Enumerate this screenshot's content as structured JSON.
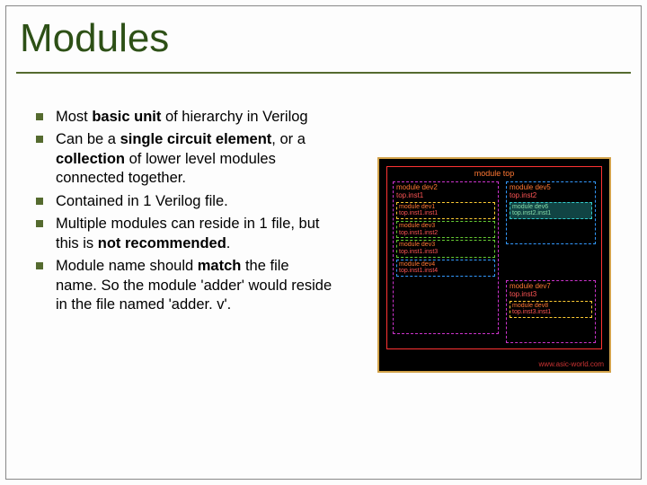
{
  "title": "Modules",
  "bullets": {
    "b1_pre": "Most ",
    "b1_bold": "basic unit",
    "b1_post": " of hierarchy in Verilog",
    "b2_pre": "Can be a ",
    "b2_bold1": "single circuit element",
    "b2_mid": ", or a ",
    "b2_bold2": "collection",
    "b2_post": " of lower level modules connected together.",
    "b3": "Contained in 1 Verilog file.",
    "b4_pre": "Multiple modules can reside in 1 file, but this is ",
    "b4_bold": "not recommended",
    "b4_post": ".",
    "b5_pre": "Module name should ",
    "b5_bold": "match",
    "b5_post": " the file name. So the module 'adder' would reside in the file named 'adder. v'."
  },
  "diagram": {
    "top_label": "module top",
    "dev2_name": "module dev2",
    "dev2_inst": "top.inst1",
    "dev1a_name": "module dev1",
    "dev1a_inst": "top.inst1.inst1",
    "dev3a_name": "module dev3",
    "dev3a_inst": "top.inst1.inst2",
    "dev3b_name": "module dev3",
    "dev3b_inst": "top.inst1.inst3",
    "dev4_name": "module dev4",
    "dev4_inst": "top.inst1.inst4",
    "dev5_name": "module dev5",
    "dev5_inst": "top.inst2",
    "dev6_name": "module dev6",
    "dev6_inst": "top.inst2.inst1",
    "dev7_name": "module dev7",
    "dev7_inst": "top.inst3",
    "dev8_name": "module dev8",
    "dev8_inst": "top.inst3.inst1",
    "watermark": "www.asic-world.com"
  }
}
